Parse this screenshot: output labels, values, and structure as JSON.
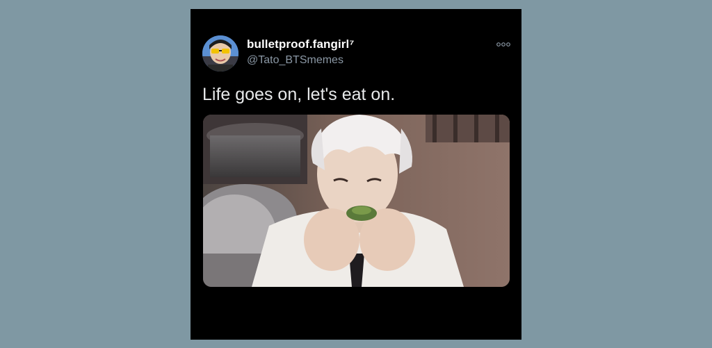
{
  "tweet": {
    "display_name": "bulletproof.fangirl⁷",
    "handle": "@Tato_BTSmemes",
    "text": "Life goes on, let's eat on.",
    "more_icon": "ellipsis-icon",
    "avatar_icon": "avatar"
  },
  "colors": {
    "page_background": "#7f98a3",
    "card_background": "#000000",
    "name_color": "#ffffff",
    "handle_color": "#8b98a5",
    "text_color": "#e7e9ea"
  }
}
